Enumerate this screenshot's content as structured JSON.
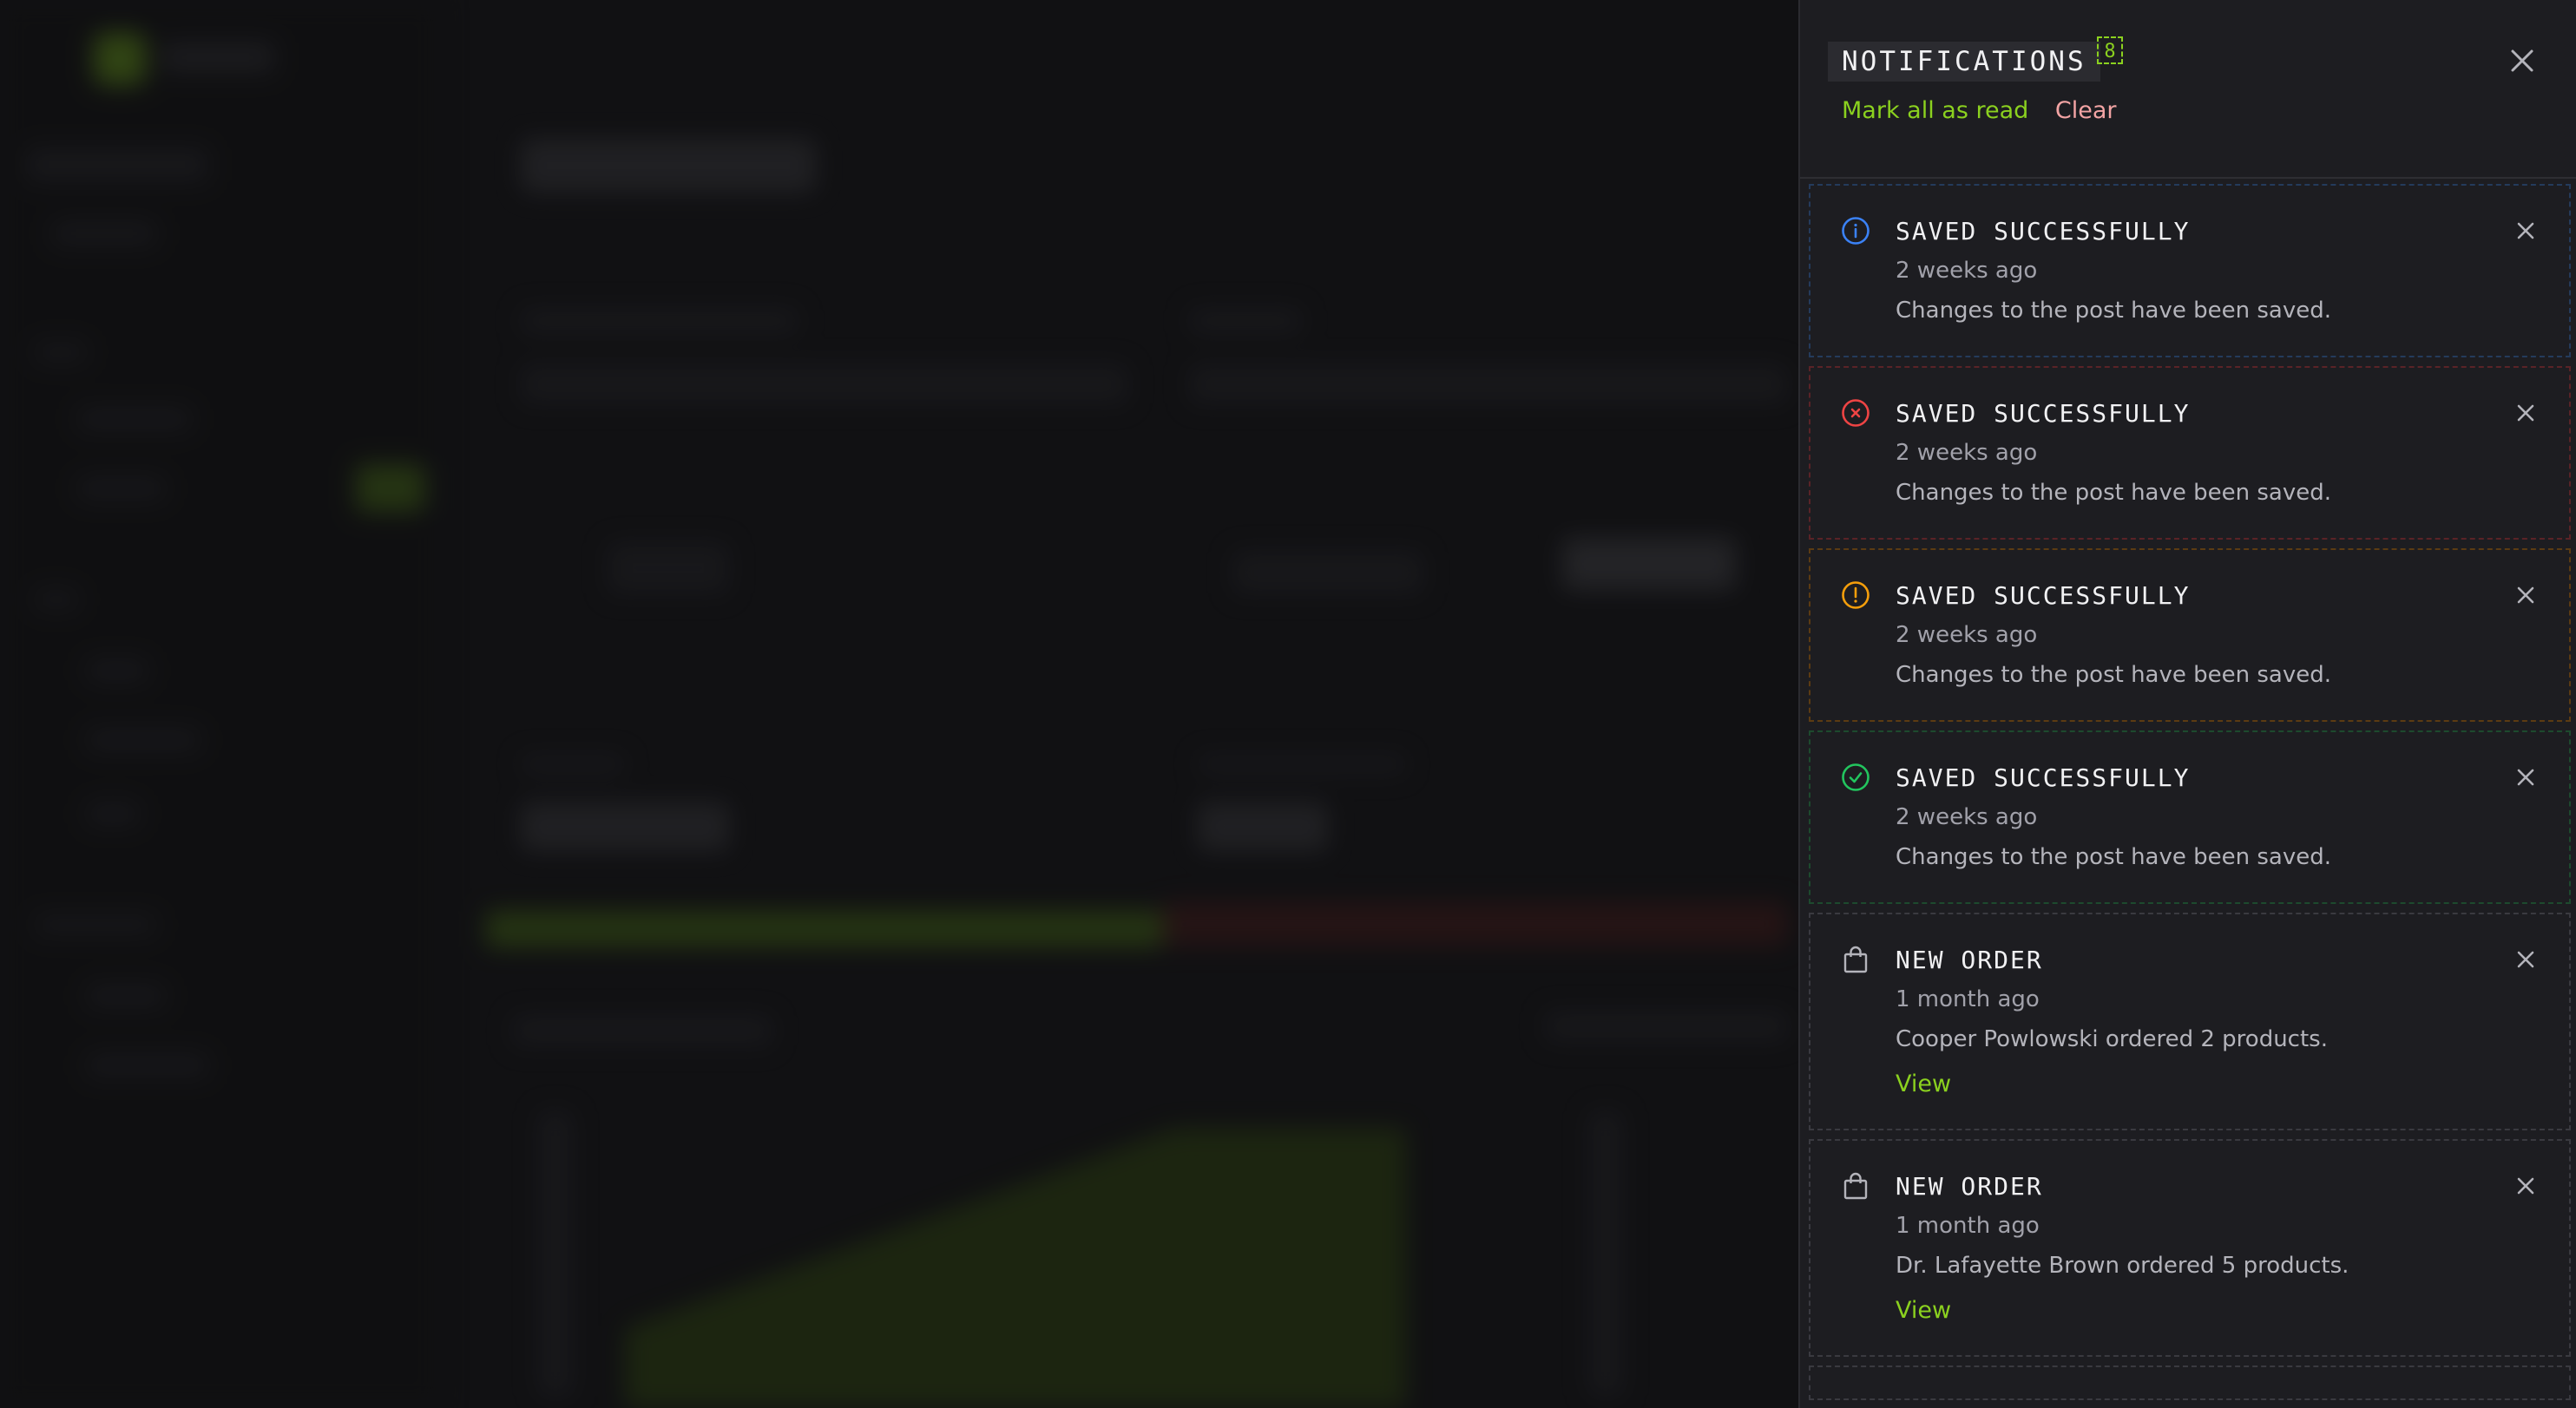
{
  "panel": {
    "title": "NOTIFICATIONS",
    "count": "8",
    "mark_all_read_label": "Mark all as read",
    "clear_label": "Clear"
  },
  "notifications": [
    {
      "kind": "info",
      "title": "SAVED SUCCESSFULLY",
      "time": "2 weeks ago",
      "message": "Changes to the post have been saved."
    },
    {
      "kind": "error",
      "title": "SAVED SUCCESSFULLY",
      "time": "2 weeks ago",
      "message": "Changes to the post have been saved."
    },
    {
      "kind": "warning",
      "title": "SAVED SUCCESSFULLY",
      "time": "2 weeks ago",
      "message": "Changes to the post have been saved."
    },
    {
      "kind": "success",
      "title": "SAVED SUCCESSFULLY",
      "time": "2 weeks ago",
      "message": "Changes to the post have been saved."
    },
    {
      "kind": "order",
      "title": "NEW ORDER",
      "time": "1 month ago",
      "message": "Cooper Powlowski ordered 2 products.",
      "action": "View"
    },
    {
      "kind": "order",
      "title": "NEW ORDER",
      "time": "1 month ago",
      "message": "Dr. Lafayette Brown ordered 5 products.",
      "action": "View"
    }
  ],
  "colors": {
    "accent": "#8bd11f",
    "info": "#3b82f6",
    "error": "#ef4444",
    "warning": "#f59e0b",
    "success": "#22c55e",
    "clear": "#f3a4a4"
  },
  "icons": {
    "info": "info-circle-icon",
    "error": "x-circle-icon",
    "warning": "exclamation-circle-icon",
    "success": "check-circle-icon",
    "order": "shopping-bag-icon",
    "close": "close-icon"
  }
}
